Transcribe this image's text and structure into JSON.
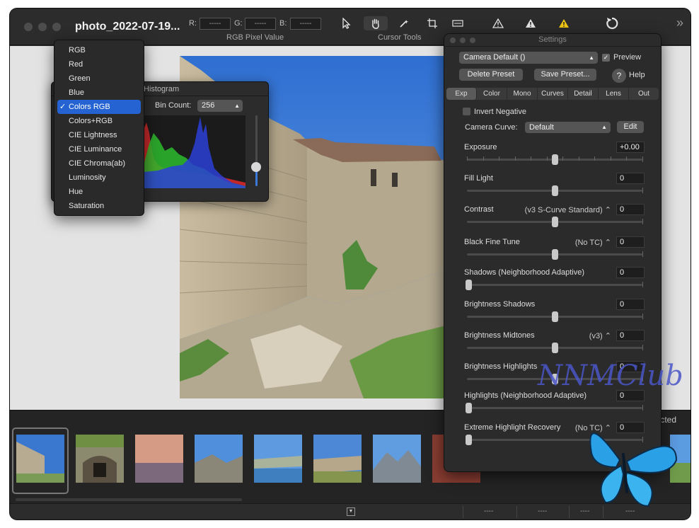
{
  "window": {
    "title": "photo_2022-07-19...",
    "rgb": {
      "r_label": "R:",
      "r_value": "-----",
      "g_label": "G:",
      "g_value": "-----",
      "b_label": "B:",
      "b_value": "-----",
      "group_label": "RGB Pixel Value"
    },
    "cursor_tools_label": "Cursor Tools"
  },
  "channel_menu": {
    "items": [
      "RGB",
      "Red",
      "Green",
      "Blue",
      "Colors RGB",
      "Colors+RGB",
      "CIE Lightness",
      "CIE Luminance",
      "CIE Chroma(ab)",
      "Luminosity",
      "Hue",
      "Saturation"
    ],
    "selected": "Colors RGB",
    "check_mark": "✓"
  },
  "histogram": {
    "title": "Histogram",
    "bin_count_label": "Bin Count:",
    "bin_count_value": "256"
  },
  "settings": {
    "title": "Settings",
    "preset_value": "Camera Default ()",
    "preview_label": "Preview",
    "preview_checked": true,
    "delete_preset": "Delete Preset",
    "save_preset": "Save Preset...",
    "help_label": "Help",
    "help_icon": "?",
    "tabs": [
      "Exp",
      "Color",
      "Mono",
      "Curves",
      "Detail",
      "Lens",
      "Out"
    ],
    "active_tab": "Exp",
    "invert_negative": "Invert Negative",
    "camera_curve_label": "Camera Curve:",
    "camera_curve_value": "Default",
    "edit_button": "Edit",
    "params": [
      {
        "label": "Exposure",
        "mode": "",
        "value": "+0.00",
        "slider_fraction": 0.5
      },
      {
        "label": "Fill Light",
        "mode": "",
        "value": "0",
        "slider_fraction": 0.5
      },
      {
        "label": "Contrast",
        "mode": "(v3 S-Curve Standard) ⌃",
        "value": "0",
        "slider_fraction": 0.5
      },
      {
        "label": "Black Fine Tune",
        "mode": "(No TC) ⌃",
        "value": "0",
        "slider_fraction": 0.5
      },
      {
        "label": "Shadows (Neighborhood Adaptive)",
        "mode": "",
        "value": "0",
        "slider_fraction": 0.0
      },
      {
        "label": "Brightness Shadows",
        "mode": "",
        "value": "0",
        "slider_fraction": 0.5
      },
      {
        "label": "Brightness Midtones",
        "mode": "(v3) ⌃",
        "value": "0",
        "slider_fraction": 0.5
      },
      {
        "label": "Brightness Highlights",
        "mode": "",
        "value": "0",
        "slider_fraction": 0.5
      },
      {
        "label": "Highlights (Neighborhood Adaptive)",
        "mode": "",
        "value": "0",
        "slider_fraction": 0.0
      },
      {
        "label": "Extreme Highlight Recovery",
        "mode": "(No TC) ⌃",
        "value": "0",
        "slider_fraction": 0.0
      }
    ]
  },
  "filmstrip": {
    "selected_text": "cted"
  },
  "statusbar": {
    "fields": [
      "----",
      "----",
      "----",
      "----"
    ]
  },
  "watermark": "NNMClub",
  "icons": {
    "arrow_tool": "arrow-cursor-icon",
    "hand_tool": "hand-icon",
    "wand_tool": "magic-wand-icon",
    "crop_tool": "crop-icon",
    "level_tool": "level-icon",
    "warn_dark": "warning-outline-icon",
    "warn_light": "warning-icon",
    "warn_yellow": "warning-yellow-icon",
    "rotate": "rotate-icon",
    "more": "chevron-double-right-icon"
  }
}
